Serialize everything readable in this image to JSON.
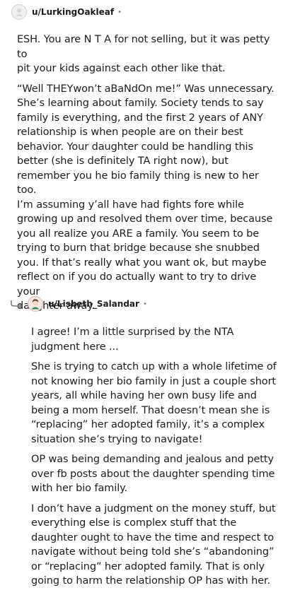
{
  "comments": [
    {
      "username": "u/LurkingOakleaf",
      "separator": "•",
      "avatar_icon": "user-avatar",
      "paragraphs": [
        "ESH. You are N T A for not selling, but it was petty to\npit your kids against each other like that.",
        "“Well THEYwon’t aBaNdOn me!” Was unnecessary.\nShe’s learning about family. Society tends to say\nfamily is everything, and the first 2 years of ANY\nrelationship is when people are on their best\nbehavior. Your daughter could be handling this\nbetter (she is definitely TA right now), but\nremember you he bio family thing is new to her too.\nI’m assuming y’all have had fights fore while\ngrowing up and resolved them over time, because\nyou all realize you ARE a family. You seem to be\ntrying to burn that bridge because she snubbed\nyou. If that’s really what you want ok, but maybe\nreflect on if you do actually want to try to drive your\ndaughter away."
      ]
    },
    {
      "username": "u/Lisbeth_Salandar",
      "separator": "•",
      "avatar_icon": "user-avatar",
      "reply_icon": "reply-arrow-icon",
      "paragraphs": [
        "I agree! I’m a little surprised by the NTA\njudgment here ...",
        "She is trying to catch up with a whole lifetime of\nnot knowing her bio family in just a couple short\nyears, all while having her own busy life and\nbeing a mom herself. That doesn’t mean she is\n“replacing” her adopted family, it’s a complex\nsituation she’s trying to navigate!",
        "OP was being demanding and jealous and petty\nover fb posts about the daughter spending time\nwith her bio family.",
        "I don’t have a judgment on the money stuff, but\neverything else is complex stuff that the\ndaughter ought to have the time and respect to\nnavigate without being told she’s “abandoning”\nor “replacing” her adopted family. That is only\ngoing to harm the relationship OP has with her."
      ]
    }
  ]
}
